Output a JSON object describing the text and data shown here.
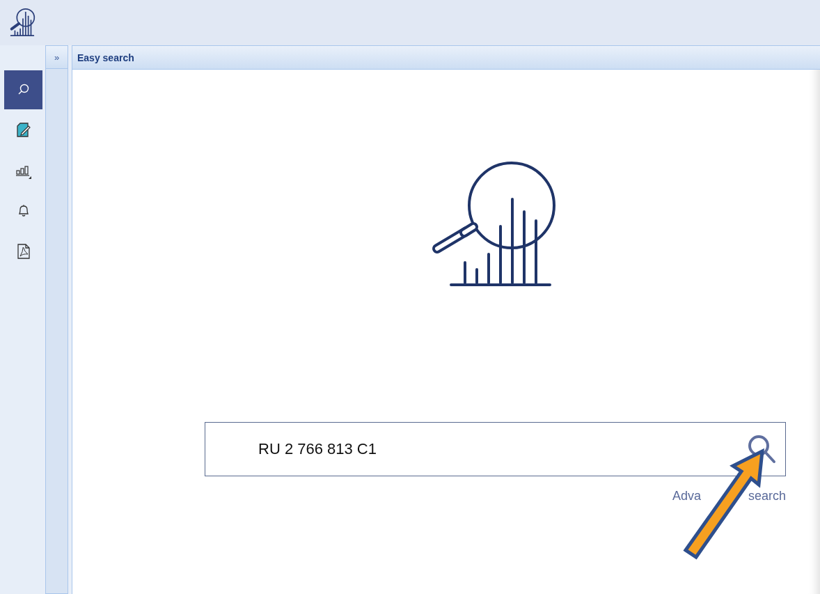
{
  "sidebar": {
    "items": [
      {
        "kind": "search",
        "selected": true
      },
      {
        "kind": "edit",
        "selected": false
      },
      {
        "kind": "chart",
        "selected": false
      },
      {
        "kind": "bell",
        "selected": false
      },
      {
        "kind": "pdf",
        "selected": false
      }
    ]
  },
  "collapse_button": "»",
  "panel": {
    "title": "Easy search"
  },
  "search": {
    "value": "RU 2 766 813 C1",
    "link_parts": [
      "Adva",
      "search"
    ]
  }
}
